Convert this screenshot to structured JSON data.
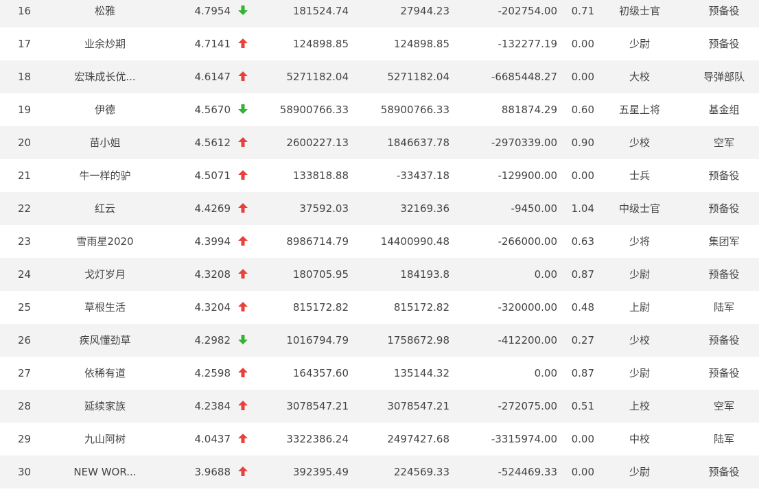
{
  "colors": {
    "up": "#e8413b",
    "down": "#34b233",
    "row_odd": "#f3f3f3",
    "row_even": "#ffffff",
    "text": "#444444"
  },
  "rows": [
    {
      "rank": "16",
      "name": "松雅",
      "score": "4.7954",
      "trend": "down",
      "v1": "181524.74",
      "v2": "27944.23",
      "v3": "-202754.00",
      "ratio": "0.71",
      "rank_title": "初级士官",
      "unit": "预备役"
    },
    {
      "rank": "17",
      "name": "业余炒期",
      "score": "4.7141",
      "trend": "up",
      "v1": "124898.85",
      "v2": "124898.85",
      "v3": "-132277.19",
      "ratio": "0.00",
      "rank_title": "少尉",
      "unit": "预备役"
    },
    {
      "rank": "18",
      "name": "宏珠成长优...",
      "score": "4.6147",
      "trend": "up",
      "v1": "5271182.04",
      "v2": "5271182.04",
      "v3": "-6685448.27",
      "ratio": "0.00",
      "rank_title": "大校",
      "unit": "导弹部队"
    },
    {
      "rank": "19",
      "name": "伊德",
      "score": "4.5670",
      "trend": "down",
      "v1": "58900766.33",
      "v2": "58900766.33",
      "v3": "881874.29",
      "ratio": "0.60",
      "rank_title": "五星上将",
      "unit": "基金组"
    },
    {
      "rank": "20",
      "name": "苗小姐",
      "score": "4.5612",
      "trend": "up",
      "v1": "2600227.13",
      "v2": "1846637.78",
      "v3": "-2970339.00",
      "ratio": "0.90",
      "rank_title": "少校",
      "unit": "空军"
    },
    {
      "rank": "21",
      "name": "牛一样的驴",
      "score": "4.5071",
      "trend": "up",
      "v1": "133818.88",
      "v2": "-33437.18",
      "v3": "-129900.00",
      "ratio": "0.00",
      "rank_title": "士兵",
      "unit": "预备役"
    },
    {
      "rank": "22",
      "name": "红云",
      "score": "4.4269",
      "trend": "up",
      "v1": "37592.03",
      "v2": "32169.36",
      "v3": "-9450.00",
      "ratio": "1.04",
      "rank_title": "中级士官",
      "unit": "预备役"
    },
    {
      "rank": "23",
      "name": "雪雨星2020",
      "score": "4.3994",
      "trend": "up",
      "v1": "8986714.79",
      "v2": "14400990.48",
      "v3": "-266000.00",
      "ratio": "0.63",
      "rank_title": "少将",
      "unit": "集团军"
    },
    {
      "rank": "24",
      "name": "戈灯岁月",
      "score": "4.3208",
      "trend": "up",
      "v1": "180705.95",
      "v2": "184193.8",
      "v3": "0.00",
      "ratio": "0.87",
      "rank_title": "少尉",
      "unit": "预备役"
    },
    {
      "rank": "25",
      "name": "草根生活",
      "score": "4.3204",
      "trend": "up",
      "v1": "815172.82",
      "v2": "815172.82",
      "v3": "-320000.00",
      "ratio": "0.48",
      "rank_title": "上尉",
      "unit": "陆军"
    },
    {
      "rank": "26",
      "name": "疾风懂劲草",
      "score": "4.2982",
      "trend": "down",
      "v1": "1016794.79",
      "v2": "1758672.98",
      "v3": "-412200.00",
      "ratio": "0.27",
      "rank_title": "少校",
      "unit": "预备役"
    },
    {
      "rank": "27",
      "name": "依稀有道",
      "score": "4.2598",
      "trend": "up",
      "v1": "164357.60",
      "v2": "135144.32",
      "v3": "0.00",
      "ratio": "0.87",
      "rank_title": "少尉",
      "unit": "预备役"
    },
    {
      "rank": "28",
      "name": "延续家族",
      "score": "4.2384",
      "trend": "up",
      "v1": "3078547.21",
      "v2": "3078547.21",
      "v3": "-272075.00",
      "ratio": "0.51",
      "rank_title": "上校",
      "unit": "空军"
    },
    {
      "rank": "29",
      "name": "九山阿树",
      "score": "4.0437",
      "trend": "up",
      "v1": "3322386.24",
      "v2": "2497427.68",
      "v3": "-3315974.00",
      "ratio": "0.00",
      "rank_title": "中校",
      "unit": "陆军"
    },
    {
      "rank": "30",
      "name": "NEW WOR...",
      "score": "3.9688",
      "trend": "up",
      "v1": "392395.49",
      "v2": "224569.33",
      "v3": "-524469.33",
      "ratio": "0.00",
      "rank_title": "少尉",
      "unit": "预备役"
    }
  ]
}
